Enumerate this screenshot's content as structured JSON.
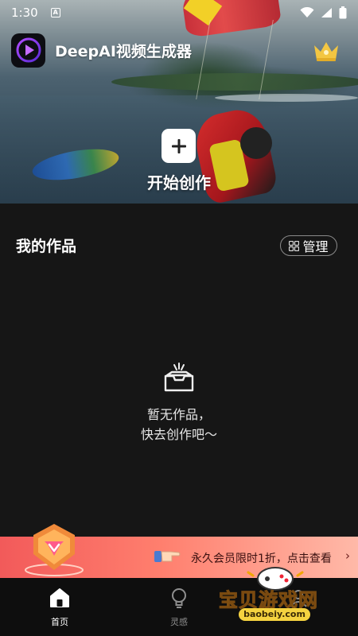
{
  "status_bar": {
    "time": "1:30",
    "notification_badge": "A",
    "icons": [
      "wifi-icon",
      "signal-icon",
      "battery-icon"
    ]
  },
  "header": {
    "app_title": "DeepAI视频生成器",
    "logo_icon": "play-logo-icon",
    "vip_icon": "crown-icon"
  },
  "hero": {
    "create_label": "开始创作",
    "create_icon": "plus-icon"
  },
  "works": {
    "title": "我的作品",
    "manage_label": "管理",
    "empty_line1": "暂无作品，",
    "empty_line2": "快去创作吧～"
  },
  "promo": {
    "text": "永久会员限时1折，点击查看",
    "arrow": "›"
  },
  "bottom_nav": {
    "items": [
      {
        "label": "首页",
        "icon": "home-icon",
        "active": true
      },
      {
        "label": "灵感",
        "icon": "lightbulb-icon",
        "active": false
      },
      {
        "label": "",
        "icon": "",
        "active": false
      }
    ]
  },
  "watermark": {
    "text": "宝贝游戏网",
    "url": "baobeiy.com"
  },
  "colors": {
    "background": "#161616",
    "promo_start": "#f25a5a",
    "promo_end": "#ffb9a8",
    "crown": "#f3c642",
    "nav_bg": "#0e0e0e"
  }
}
